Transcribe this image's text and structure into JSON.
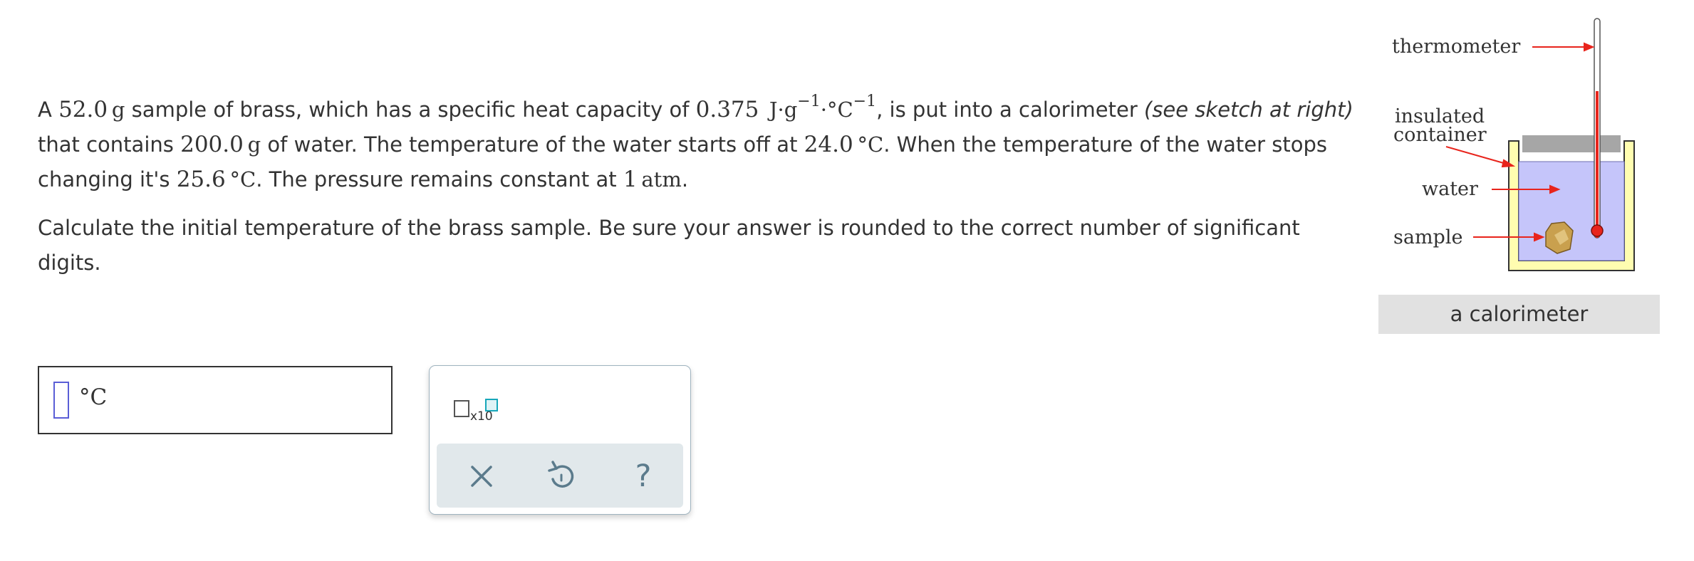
{
  "problem": {
    "p1": {
      "t1": "A ",
      "mass_brass": "52.0",
      "unit_g1": "g",
      "t2": " sample of brass, which has a specific heat capacity of ",
      "heat_capacity": "0.375",
      "unit_J": "J·g",
      "exp1": "−1",
      "unit_dot_C": "·°C",
      "exp2": "−1",
      "t3": ", is put into a calorimeter ",
      "see_sketch": "(see sketch at right)",
      "t4": " that contains ",
      "mass_water": "200.0",
      "unit_g2": "g",
      "t5": " of water. The temperature of the water starts off at ",
      "temp_start": "24.0",
      "unit_C1": "°C",
      "t6": ". When the temperature of the water stops changing it's ",
      "temp_final": "25.6",
      "unit_C2": "°C",
      "t7": ". The pressure remains constant at ",
      "pressure": "1",
      "unit_atm": "atm",
      "t8": "."
    },
    "question": "Calculate the initial temperature of the brass sample. Be sure your answer is rounded to the correct number of significant digits."
  },
  "sketch": {
    "labels": {
      "thermometer": "thermometer",
      "insulated_line1": "insulated",
      "insulated_line2": "container",
      "water": "water",
      "sample": "sample"
    },
    "caption": "a calorimeter",
    "colors": {
      "container": "#fffdb0",
      "water": "#c5c5fa",
      "lid": "#a6a6a6",
      "arrow": "#e8241c",
      "sample": "#c9a04e"
    }
  },
  "answer": {
    "value": "",
    "unit": "°C"
  },
  "tools": {
    "x10_label": "x10",
    "icons": {
      "x10": "x10-icon",
      "clear": "close-icon",
      "undo": "undo-icon",
      "help": "help-icon"
    },
    "help_glyph": "?"
  }
}
